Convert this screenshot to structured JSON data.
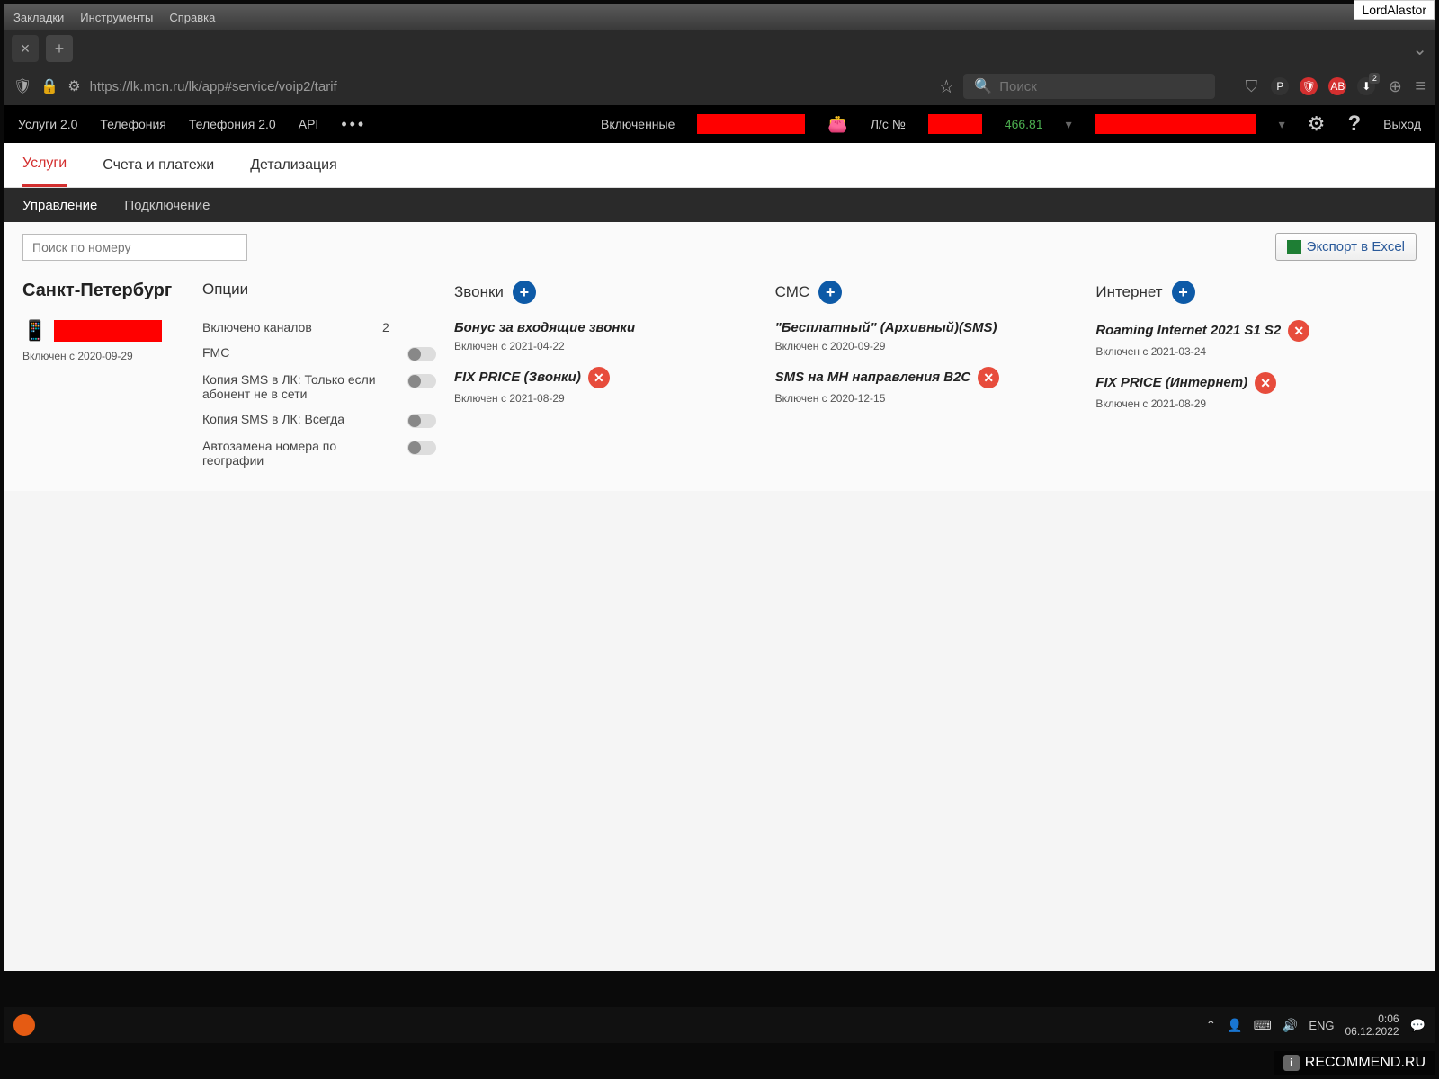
{
  "watermark": {
    "user": "LordAlastor",
    "site": "RECOMMEND.RU"
  },
  "menubar": {
    "bookmarks": "Закладки",
    "tools": "Инструменты",
    "help": "Справка"
  },
  "url": "https://lk.mcn.ru/lk/app#service/voip2/tarif",
  "search_placeholder": "Поиск",
  "topnav": {
    "services": "Услуги 2.0",
    "telephony": "Телефония",
    "telephony2": "Телефония 2.0",
    "api": "API",
    "included": "Включенные",
    "account_label": "Л/с №",
    "balance": "466.81",
    "exit": "Выход"
  },
  "subnav": {
    "services": "Услуги",
    "billing": "Счета и платежи",
    "details": "Детализация"
  },
  "subnav2": {
    "manage": "Управление",
    "connect": "Подключение"
  },
  "toolbar": {
    "search_placeholder": "Поиск по номеру",
    "export": "Экспорт в Excel"
  },
  "city": "Санкт-Петербург",
  "phone": {
    "enabled_since": "Включен с 2020-09-29"
  },
  "headers": {
    "options": "Опции",
    "calls": "Звонки",
    "sms": "СМС",
    "internet": "Интернет"
  },
  "options": {
    "channels": {
      "label": "Включено каналов",
      "value": "2"
    },
    "fmc": {
      "label": "FMC"
    },
    "sms_offline": {
      "label": "Копия SMS в ЛК: Только если абонент не в сети"
    },
    "sms_always": {
      "label": "Копия SMS в ЛК: Всегда"
    },
    "georeplace": {
      "label": "Автозамена номера по географии"
    }
  },
  "calls": [
    {
      "title": "Бонус за входящие звонки",
      "since": "Включен с 2021-04-22",
      "deletable": false
    },
    {
      "title": "FIX PRICE (Звонки)",
      "since": "Включен с 2021-08-29",
      "deletable": true
    }
  ],
  "sms": [
    {
      "title": "\"Бесплатный\" (Архивный)(SMS)",
      "since": "Включен с 2020-09-29",
      "deletable": false
    },
    {
      "title": "SMS на МН направления B2C",
      "since": "Включен с 2020-12-15",
      "deletable": true
    }
  ],
  "internet": [
    {
      "title": "Roaming Internet 2021 S1 S2",
      "since": "Включен с 2021-03-24",
      "deletable": true
    },
    {
      "title": "FIX PRICE (Интернет)",
      "since": "Включен с 2021-08-29",
      "deletable": true
    }
  ],
  "taskbar": {
    "lang": "ENG",
    "time": "0:06",
    "date": "06.12.2022"
  }
}
